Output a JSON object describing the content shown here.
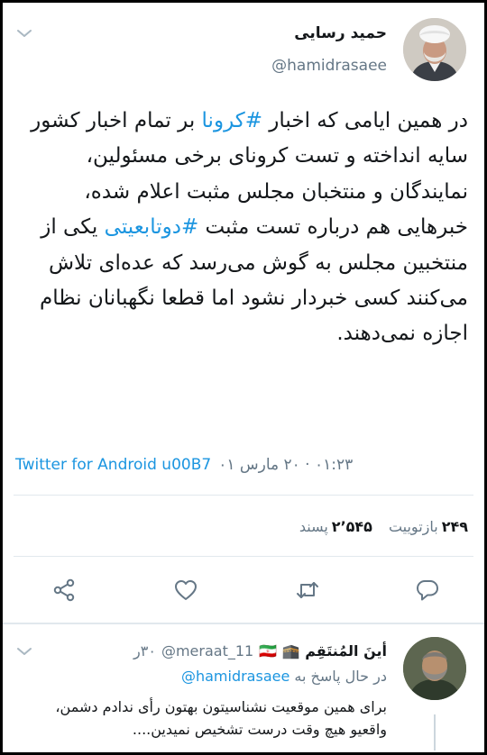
{
  "tweet": {
    "display_name": "حمید رسایی",
    "handle": "@hamidrasaee",
    "body": {
      "before_tag1": "در همین ایامی که اخبار ",
      "tag1": "#کرونا",
      "between": " بر تمام اخبار کشور سایه انداخته و تست کرونای برخی مسئولین، نمایندگان و منتخبان مجلس مثبت اعلام شده، خبرهایی هم درباره تست مثبت ",
      "tag2": "#دوتابعیتی",
      "after_tag2": " یکی از منتخبین مجلس به گوش می‌رسد که عده‌ای تلاش می‌کنند کسی خبردار نشود اما قطعا نگهبانان نظام اجازه نمی‌دهند."
    },
    "timestamp": "۰۱:۲۳ · ۲۰ مارس ۰۱",
    "source": "Twitter for Android u00B7",
    "retweets_count": "۲۴۹",
    "retweets_label": "بازتوییت",
    "likes_count": "۲٬۵۴۵",
    "likes_label": "پسند"
  },
  "reply": {
    "display_name": "أینَ المُنتَقِم 🕋 🇮🇷",
    "handle": "@meraat_11",
    "time": "۳۰ر",
    "replying_prefix": "در حال پاسخ به",
    "replying_to": "@hamidrasaee",
    "text": "برای همین موقعیت نشناسیتون بهتون رأی ندادم دشمن، واقعیو هیچ وقت درست تشخیص نمیدین...."
  },
  "icons": {
    "caret": "chevron-down-icon",
    "share": "share-icon",
    "like": "heart-icon",
    "retweet": "retweet-icon",
    "reply": "reply-icon"
  },
  "colors": {
    "accent": "#1b95e0",
    "secondary_text": "#657786",
    "divider": "#e1e8ed"
  }
}
